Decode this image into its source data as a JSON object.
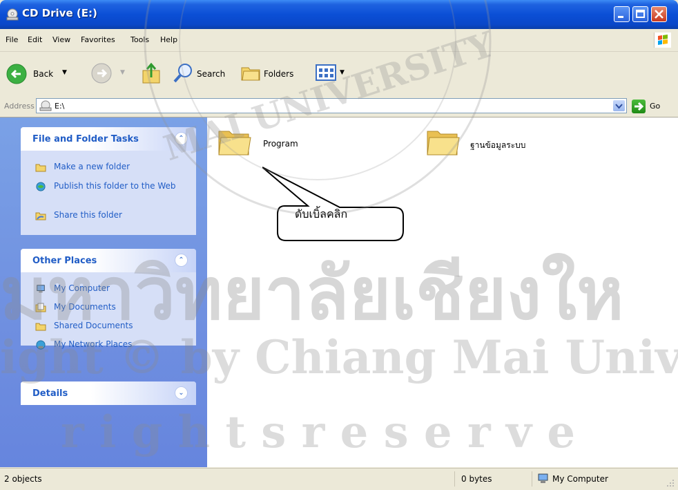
{
  "window": {
    "title": "CD Drive (E:)"
  },
  "menu": {
    "items": [
      "File",
      "Edit",
      "View",
      "Favorites",
      "Tools",
      "Help"
    ]
  },
  "toolbar": {
    "back_label": "Back",
    "search_label": "Search",
    "folders_label": "Folders"
  },
  "address": {
    "label": "Address",
    "value": "E:\\",
    "go_label": "Go"
  },
  "panels": {
    "file_tasks": {
      "title": "File and Folder Tasks",
      "items": [
        "Make a new folder",
        "Publish this folder to the Web",
        "Share this folder"
      ]
    },
    "other_places": {
      "title": "Other Places",
      "items": [
        "My Computer",
        "My Documents",
        "Shared Documents",
        "My Network Places"
      ]
    },
    "details": {
      "title": "Details"
    }
  },
  "files": [
    {
      "name": "Program"
    },
    {
      "name": "ฐานข้อมูลระบบ"
    }
  ],
  "callout": {
    "text": "ดับเบิ้ลคลิก"
  },
  "status": {
    "objects": "2 objects",
    "size": "0 bytes",
    "location": "My Computer"
  },
  "watermark": {
    "line1": "มหาวิทยาลัยเชียงให",
    "line2": "ight © by Chiang Mai Univers",
    "line3": "r i g h t s   r e s e r v e",
    "seal_text": "MAI UNIVERSITY"
  }
}
